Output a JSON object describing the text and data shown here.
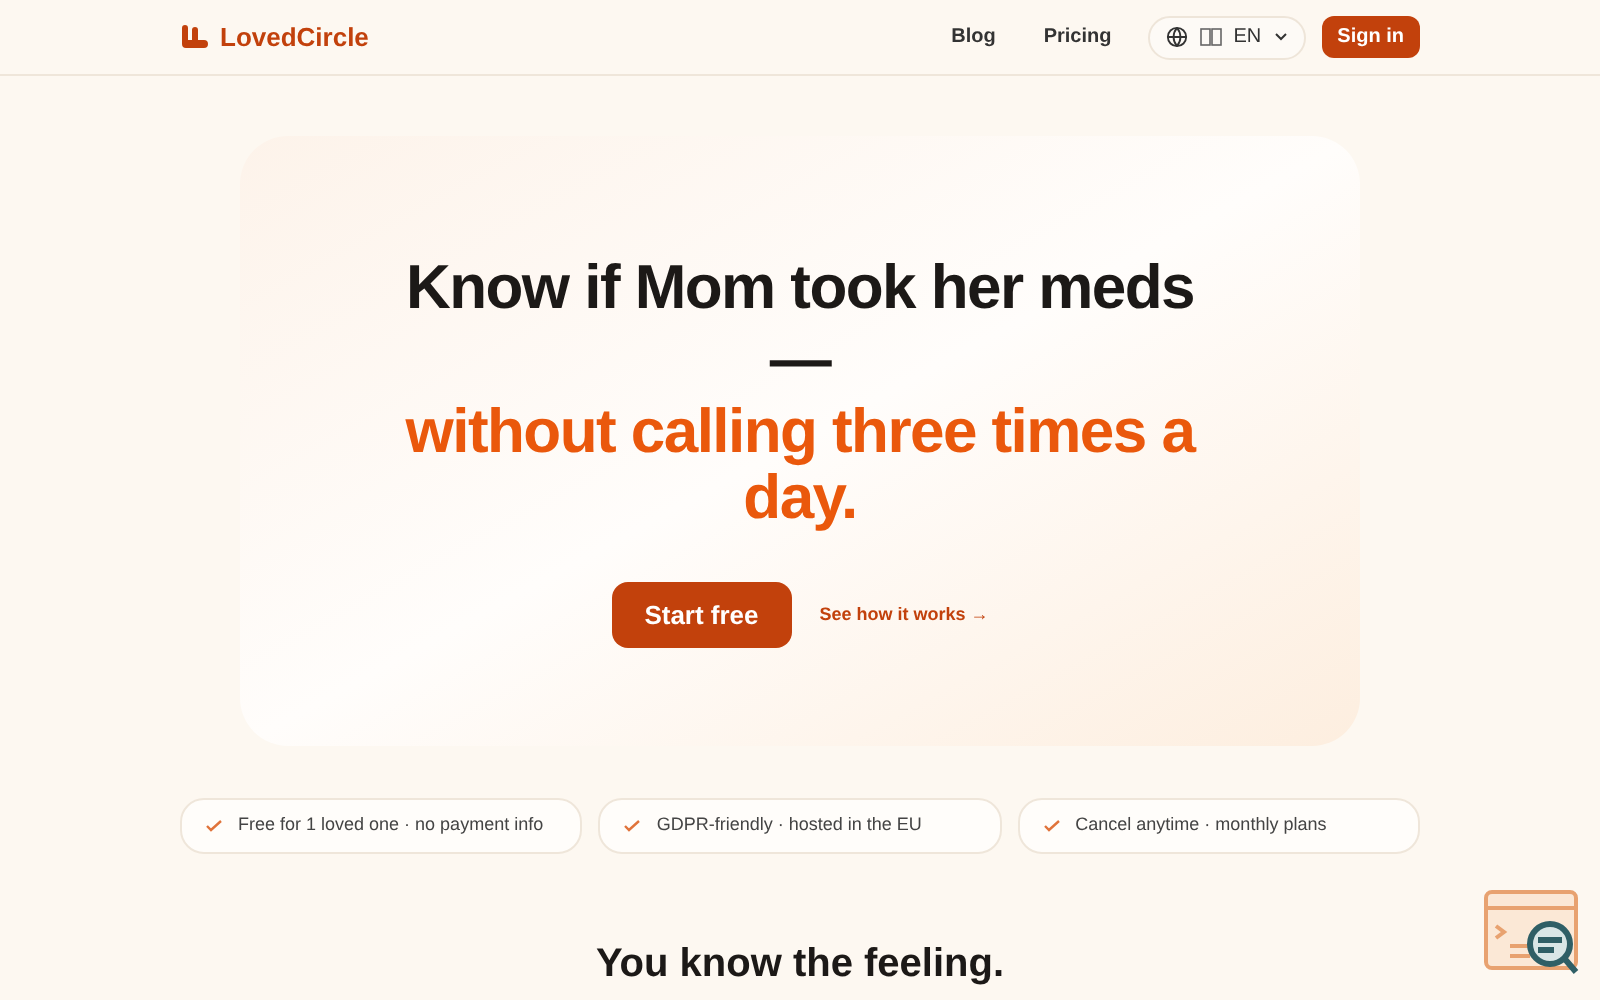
{
  "header": {
    "brand": "LovedCircle",
    "nav": [
      "Blog",
      "Pricing"
    ],
    "language": "EN",
    "sign_in": "Sign in"
  },
  "hero": {
    "title": "Know if Mom took her meds —",
    "highlight": "without calling three times a day.",
    "primary_button": "Start free",
    "secondary_link": "See how it works →"
  },
  "features": [
    "Free for 1 loved one · no payment info",
    "GDPR-friendly · hosted in the EU",
    "Cancel anytime · monthly plans"
  ],
  "section_title": "You know the feeling."
}
